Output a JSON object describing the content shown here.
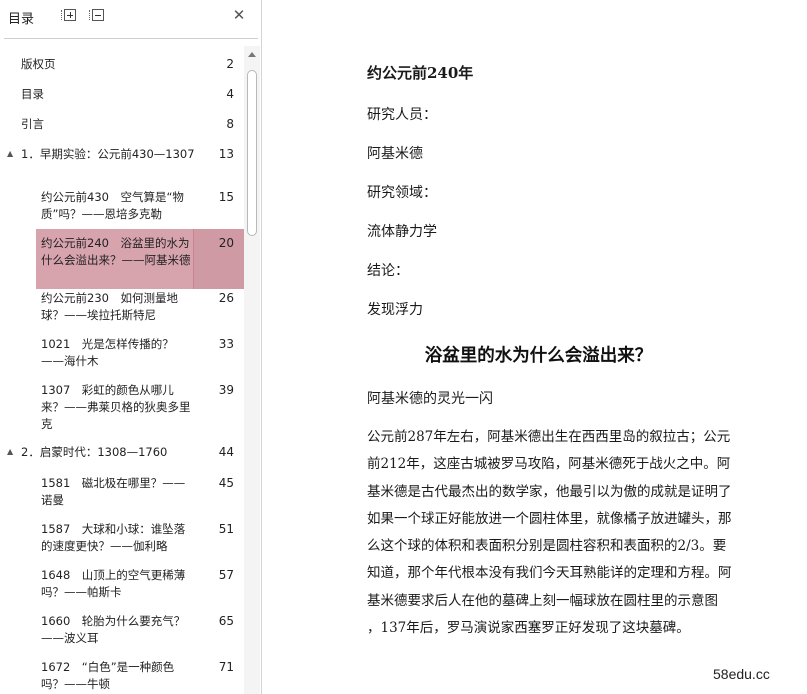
{
  "toc": {
    "title": "目录",
    "expand_all_icon": "expand-all-icon",
    "collapse_all_icon": "collapse-all-icon",
    "close_label": "✕",
    "items": [
      {
        "label": "版权页",
        "page": "2",
        "level": 0
      },
      {
        "label": "目录",
        "page": "4",
        "level": 0
      },
      {
        "label": "引言",
        "page": "8",
        "level": 0
      },
      {
        "label": "1．早期实验：公元前430—1307",
        "page": "13",
        "level": 0,
        "twisty": "▲"
      },
      {
        "label": "约公元前430　空气算是“物质”吗？——恩培多克勒",
        "page": "15",
        "level": 1
      },
      {
        "label": "约公元前240　浴盆里的水为什么会溢出来？——阿基米德",
        "page": "20",
        "level": 1,
        "active": true
      },
      {
        "label": "约公元前230　如何测量地球？——埃拉托斯特尼",
        "page": "26",
        "level": 1
      },
      {
        "label": "1021　光是怎样传播的？——海什木",
        "page": "33",
        "level": 1
      },
      {
        "label": "1307　彩虹的颜色从哪儿来？——弗莱贝格的狄奥多里克",
        "page": "39",
        "level": 1
      },
      {
        "label": "2．启蒙时代：1308—1760",
        "page": "44",
        "level": 0,
        "twisty": "▲"
      },
      {
        "label": "1581　磁北极在哪里？——诺曼",
        "page": "45",
        "level": 1
      },
      {
        "label": "1587　大球和小球：谁坠落的速度更快？——伽利略",
        "page": "51",
        "level": 1
      },
      {
        "label": "1648　山顶上的空气更稀薄吗？——帕斯卡",
        "page": "57",
        "level": 1
      },
      {
        "label": "1660　轮胎为什么要充气？——波义耳",
        "page": "65",
        "level": 1
      },
      {
        "label": "1672　“白色”是一种颜色吗？——牛顿",
        "page": "71",
        "level": 1
      }
    ]
  },
  "document": {
    "date_heading": "约公元前240年",
    "researcher_label": "研究人员：",
    "researcher": "阿基米德",
    "field_label": "研究领域：",
    "field": "流体静力学",
    "conclusion_label": "结论：",
    "conclusion": "发现浮力",
    "title": "浴盆里的水为什么会溢出来？",
    "subtitle": "阿基米德的灵光一闪",
    "body_lines": [
      "公元前287年左右，阿基米德出生在西西里岛的叙拉古；公元",
      "前212年，这座古城被罗马攻陷，阿基米德死于战火之中。阿",
      "基米德是古代最杰出的数学家，他最引以为傲的成就是证明了",
      "如果一个球正好能放进一个圆柱体里，就像橘子放进罐头，那",
      "么这个球的体积和表面积分别是圆柱容积和表面积的2/3。要",
      "知道，那个年代根本没有我们今天耳熟能详的定理和方程。阿",
      "基米德要求后人在他的墓碑上刻一幅球放在圆柱里的示意图",
      "，137年后，罗马演说家西塞罗正好发现了这块墓碑。"
    ]
  },
  "watermark": "58edu.cc",
  "colors": {
    "highlight": "#d7a3ad",
    "separator": "#cfcfcf"
  }
}
